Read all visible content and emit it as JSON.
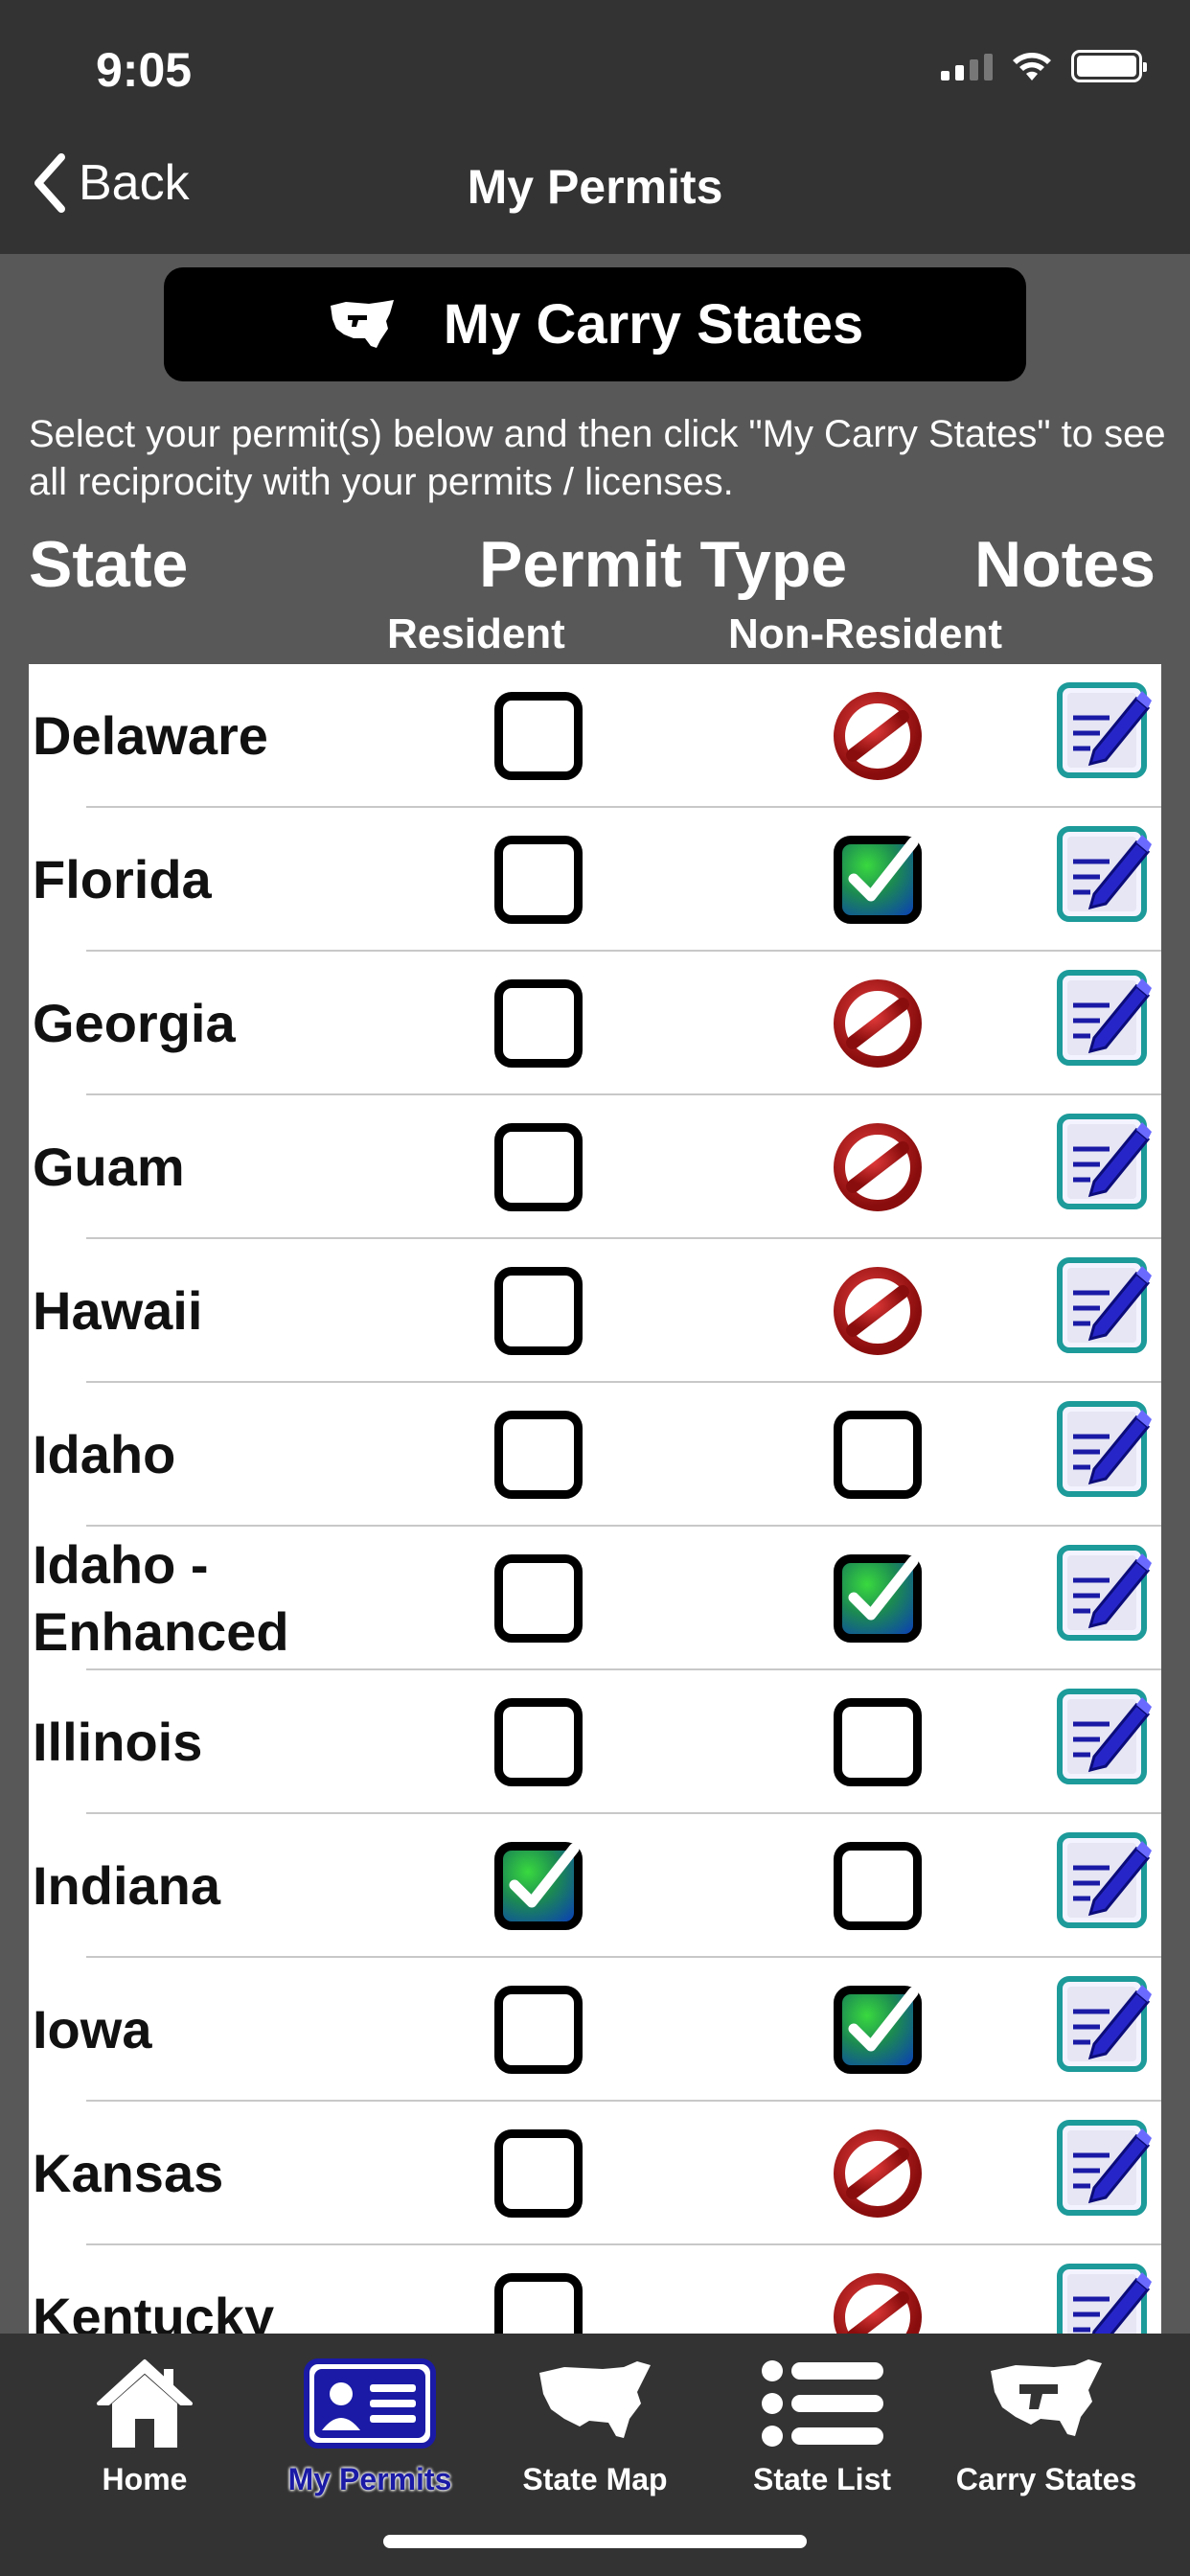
{
  "status": {
    "time": "9:05"
  },
  "nav": {
    "back_label": "Back",
    "title": "My Permits"
  },
  "carry_button": {
    "label": "My Carry States"
  },
  "instructions": "Select your permit(s) below and then click \"My Carry States\" to see all reciprocity with your permits / licenses.",
  "headers": {
    "state": "State",
    "permit_type": "Permit Type",
    "notes": "Notes",
    "resident": "Resident",
    "non_resident": "Non-Resident"
  },
  "rows": [
    {
      "state": "Delaware",
      "resident": "unchecked",
      "non_resident": "unavailable"
    },
    {
      "state": "Florida",
      "resident": "unchecked",
      "non_resident": "checked"
    },
    {
      "state": "Georgia",
      "resident": "unchecked",
      "non_resident": "unavailable"
    },
    {
      "state": "Guam",
      "resident": "unchecked",
      "non_resident": "unavailable"
    },
    {
      "state": "Hawaii",
      "resident": "unchecked",
      "non_resident": "unavailable"
    },
    {
      "state": "Idaho",
      "resident": "unchecked",
      "non_resident": "unchecked"
    },
    {
      "state": "Idaho - Enhanced",
      "resident": "unchecked",
      "non_resident": "checked"
    },
    {
      "state": "Illinois",
      "resident": "unchecked",
      "non_resident": "unchecked"
    },
    {
      "state": "Indiana",
      "resident": "checked",
      "non_resident": "unchecked"
    },
    {
      "state": "Iowa",
      "resident": "unchecked",
      "non_resident": "checked"
    },
    {
      "state": "Kansas",
      "resident": "unchecked",
      "non_resident": "unavailable"
    },
    {
      "state": "Kentucky",
      "resident": "unchecked",
      "non_resident": "unavailable"
    }
  ],
  "tabs": [
    {
      "label": "Home",
      "icon": "house-icon",
      "active": false
    },
    {
      "label": "My Permits",
      "icon": "id-card-icon",
      "active": true
    },
    {
      "label": "State Map",
      "icon": "us-map-icon",
      "active": false
    },
    {
      "label": "State List",
      "icon": "list-icon",
      "active": false
    },
    {
      "label": "Carry States",
      "icon": "carry-map-icon",
      "active": false
    }
  ],
  "colors": {
    "background": "#585858",
    "bar": "#333333",
    "prohibited": "#b01818",
    "note": "#1a1aa6",
    "note_border": "#1d9a9a"
  }
}
